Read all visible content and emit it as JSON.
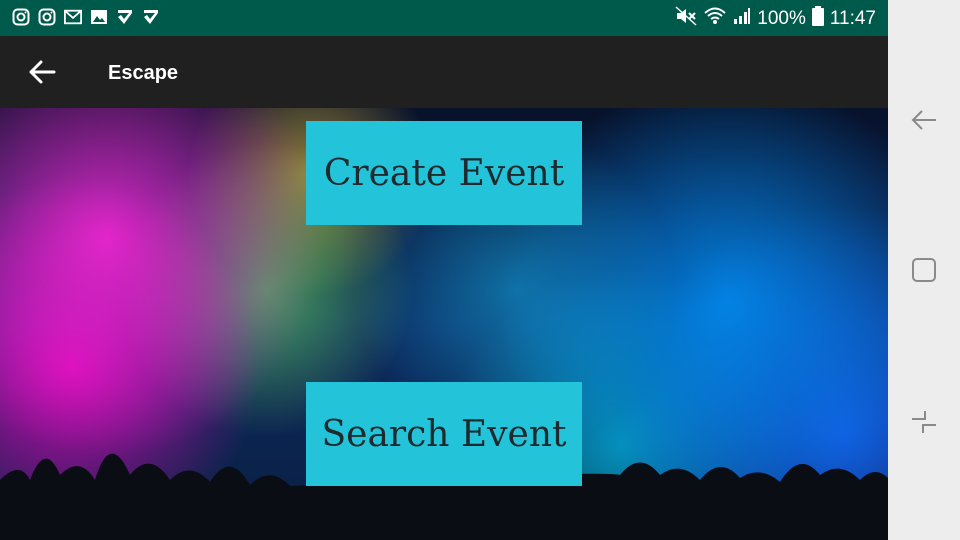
{
  "status_bar": {
    "left_icons": [
      "instagram-icon",
      "instagram-icon",
      "gmail-icon",
      "gallery-icon",
      "check-icon",
      "check-icon"
    ],
    "battery_percent": "100%",
    "time": "11:47"
  },
  "app_bar": {
    "title": "Escape"
  },
  "main": {
    "create_label": "Create Event",
    "search_label": "Search Event"
  },
  "colors": {
    "status_bar": "#005a4b",
    "app_bar": "#202020",
    "button": "#23c3d9",
    "button_text": "#1e2a2e"
  }
}
